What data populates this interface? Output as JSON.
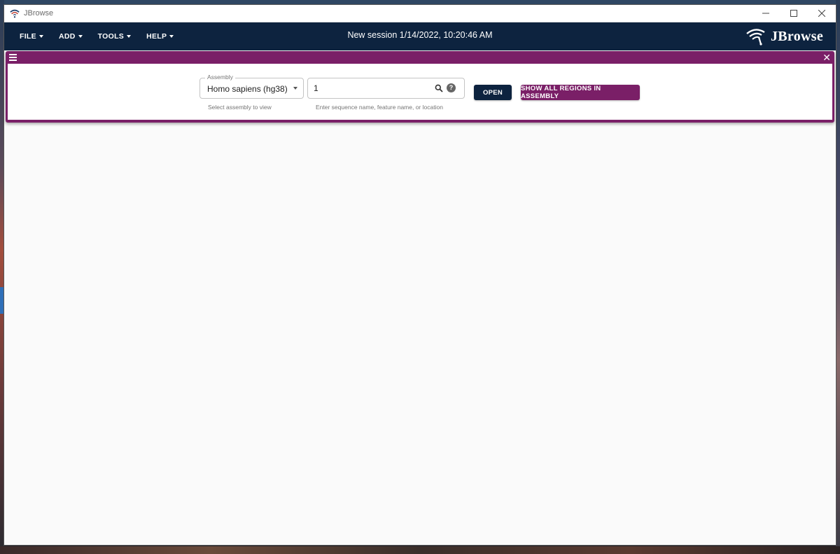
{
  "window": {
    "title": "JBrowse"
  },
  "menu": {
    "items": [
      {
        "label": "FILE"
      },
      {
        "label": "ADD"
      },
      {
        "label": "TOOLS"
      },
      {
        "label": "HELP"
      }
    ]
  },
  "session": {
    "title": "New session 1/14/2022, 10:20:46 AM"
  },
  "logo": {
    "text": "JBrowse"
  },
  "view": {
    "assembly": {
      "label": "Assembly",
      "value": "Homo sapiens (hg38)",
      "helper": "Select assembly to view"
    },
    "location": {
      "value": "1",
      "helper": "Enter sequence name, feature name, or location"
    },
    "open_label": "OPEN",
    "show_all_label": "SHOW ALL REGIONS IN ASSEMBLY"
  },
  "colors": {
    "appbar": "#0d233f",
    "accent": "#7a1f67"
  }
}
